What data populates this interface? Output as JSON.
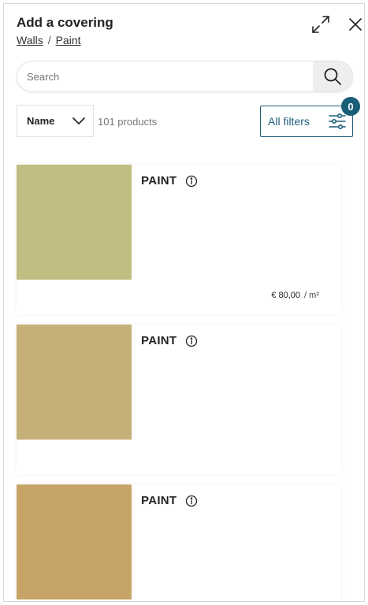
{
  "header": {
    "title": "Add a covering",
    "breadcrumb": [
      "Walls",
      "Paint"
    ],
    "breadcrumb_separator": "/"
  },
  "search": {
    "placeholder": "Search",
    "value": ""
  },
  "sort": {
    "selected": "Name"
  },
  "results": {
    "count_text": "101 products"
  },
  "filters": {
    "label": "All filters",
    "active_count": "0"
  },
  "colors": {
    "accent": "#1e5f7a",
    "badge": "#195f78"
  },
  "products": [
    {
      "name": "PAINT",
      "color": "#c0be82",
      "price": "€ 80,00",
      "unit": "/ m²"
    },
    {
      "name": "PAINT",
      "color": "#c6b07a",
      "price": "",
      "unit": ""
    },
    {
      "name": "PAINT",
      "color": "#c6a468",
      "price": "",
      "unit": ""
    }
  ],
  "icons": {
    "expand": "expand-arrows-icon",
    "close": "close-icon",
    "search": "search-icon",
    "chevron": "chevron-down-icon",
    "filters": "sliders-icon",
    "info": "info-icon"
  }
}
